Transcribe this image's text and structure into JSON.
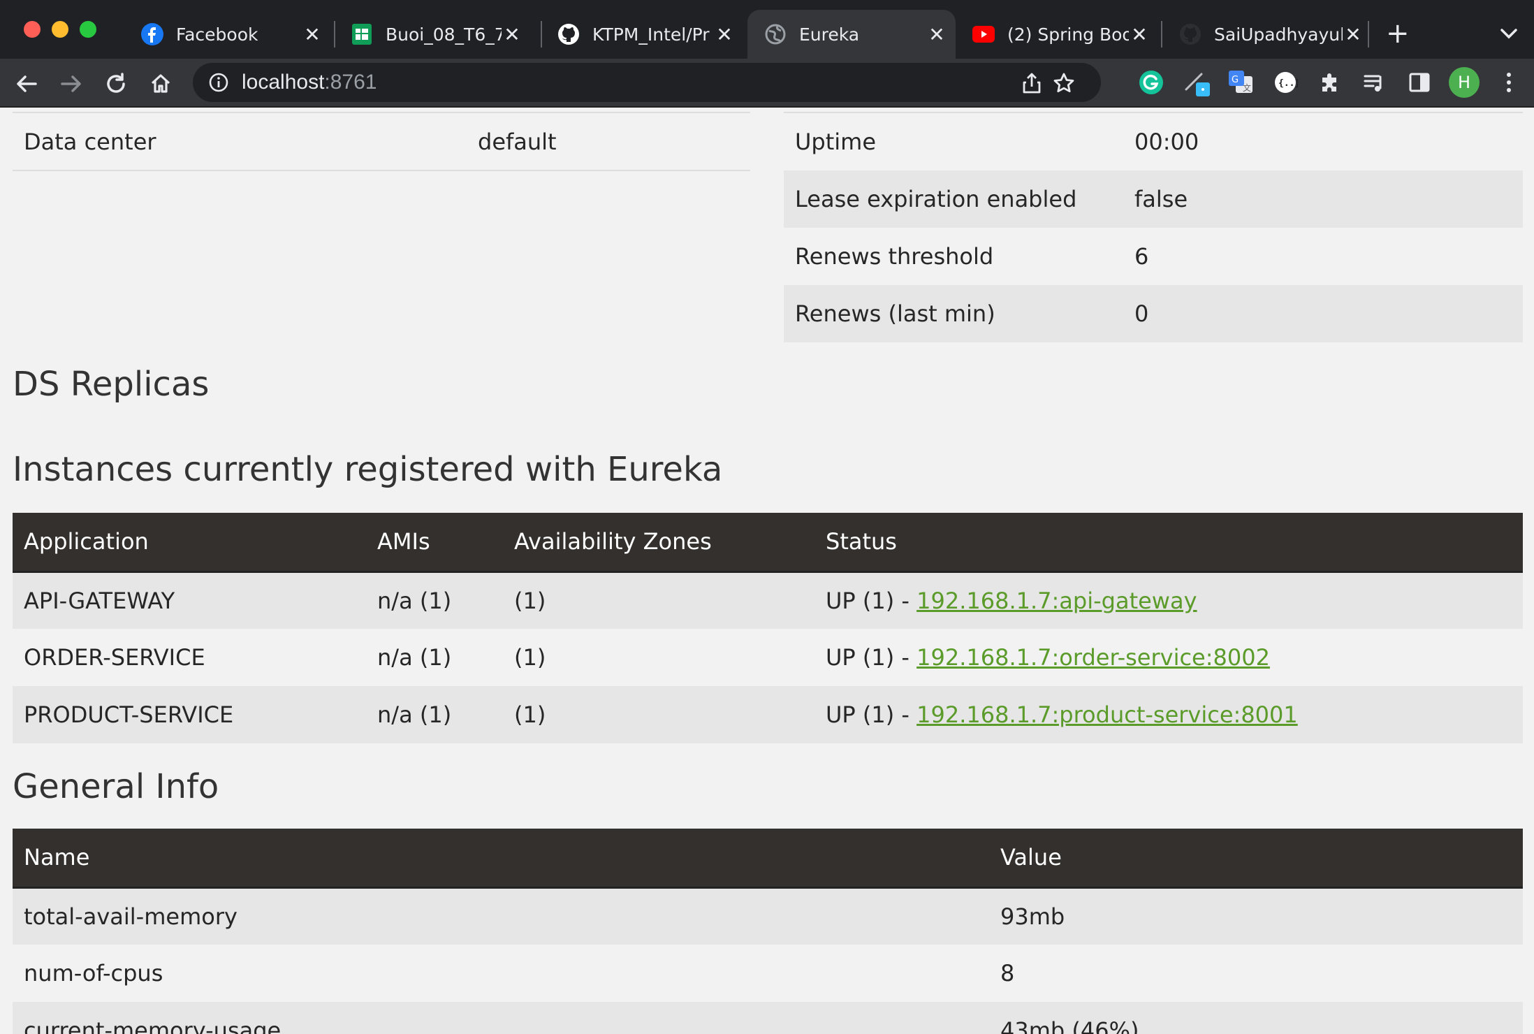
{
  "browser": {
    "tabs": [
      {
        "title": "Facebook",
        "icon": "facebook-icon",
        "active": false
      },
      {
        "title": "Buoi_08_T6_7",
        "icon": "google-sheets-icon",
        "active": false
      },
      {
        "title": "KTPM_Intel/Pr",
        "icon": "github-icon",
        "active": false
      },
      {
        "title": "Eureka",
        "icon": "globe-icon",
        "active": true
      },
      {
        "title": "(2) Spring Boo",
        "icon": "youtube-icon",
        "active": false
      },
      {
        "title": "SaiUpadhyayul",
        "icon": "github-icon",
        "active": false
      }
    ],
    "close_glyph": "✕",
    "new_tab_glyph": "+",
    "url_host": "localhost",
    "url_port": ":8761",
    "profile_initial": "H",
    "colors": {
      "tabbar": "#202124",
      "toolbar": "#35363a",
      "profile": "#4caf50"
    }
  },
  "system_status_left": [
    {
      "name": "Data center",
      "value": "default"
    }
  ],
  "system_status_right": [
    {
      "name": "Uptime",
      "value": "00:00"
    },
    {
      "name": "Lease expiration enabled",
      "value": "false"
    },
    {
      "name": "Renews threshold",
      "value": "6"
    },
    {
      "name": "Renews (last min)",
      "value": "0"
    }
  ],
  "ds_replicas": {
    "heading": "DS Replicas"
  },
  "instances": {
    "heading": "Instances currently registered with Eureka",
    "columns": [
      "Application",
      "AMIs",
      "Availability Zones",
      "Status"
    ],
    "rows": [
      {
        "application": "API-GATEWAY",
        "amis": "n/a (1)",
        "zones": "(1)",
        "status_prefix": "UP (1) - ",
        "status_link": "192.168.1.7:api-gateway"
      },
      {
        "application": "ORDER-SERVICE",
        "amis": "n/a (1)",
        "zones": "(1)",
        "status_prefix": "UP (1) - ",
        "status_link": "192.168.1.7:order-service:8002"
      },
      {
        "application": "PRODUCT-SERVICE",
        "amis": "n/a (1)",
        "zones": "(1)",
        "status_prefix": "UP (1) - ",
        "status_link": "192.168.1.7:product-service:8001"
      }
    ]
  },
  "general_info": {
    "heading": "General Info",
    "columns": [
      "Name",
      "Value"
    ],
    "rows": [
      {
        "name": "total-avail-memory",
        "value": "93mb"
      },
      {
        "name": "num-of-cpus",
        "value": "8"
      },
      {
        "name": "current-memory-usage",
        "value": "43mb (46%)"
      }
    ]
  },
  "colors": {
    "header_bg": "#33302d",
    "link": "#5b9b2a",
    "row_alt": "#e6e6e6"
  }
}
